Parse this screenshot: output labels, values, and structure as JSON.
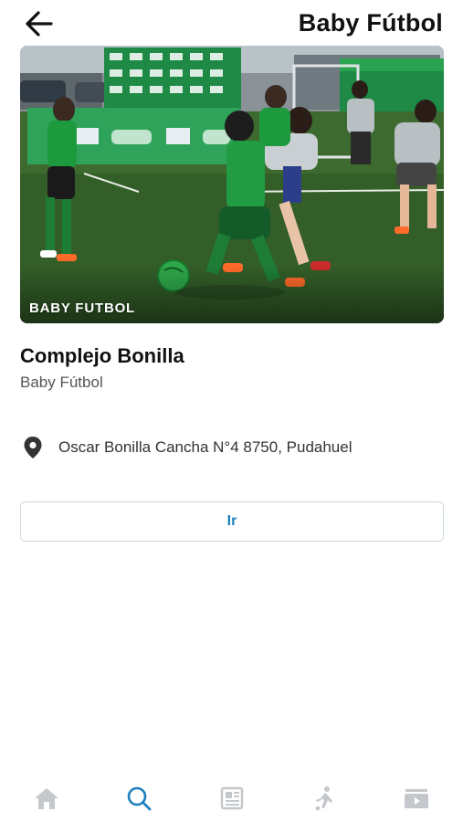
{
  "header": {
    "title": "Baby Fútbol",
    "back_icon": "arrow-left-icon"
  },
  "hero": {
    "caption": "BABY FUTBOL"
  },
  "venue": {
    "name": "Complejo Bonilla",
    "category": "Baby Fútbol"
  },
  "address": {
    "icon": "location-pin-icon",
    "text": "Oscar Bonilla Cancha N°4 8750, Pudahuel"
  },
  "action": {
    "go_label": "Ir"
  },
  "tabbar": {
    "active_index": 1,
    "active_color": "#1e7fbf",
    "inactive_color": "#c4c8cc",
    "items": [
      {
        "icon": "home-icon"
      },
      {
        "icon": "search-icon"
      },
      {
        "icon": "news-icon"
      },
      {
        "icon": "player-icon"
      },
      {
        "icon": "video-icon"
      }
    ]
  },
  "colors": {
    "accent": "#1e7fbf",
    "text": "#111111",
    "muted": "#555555"
  }
}
